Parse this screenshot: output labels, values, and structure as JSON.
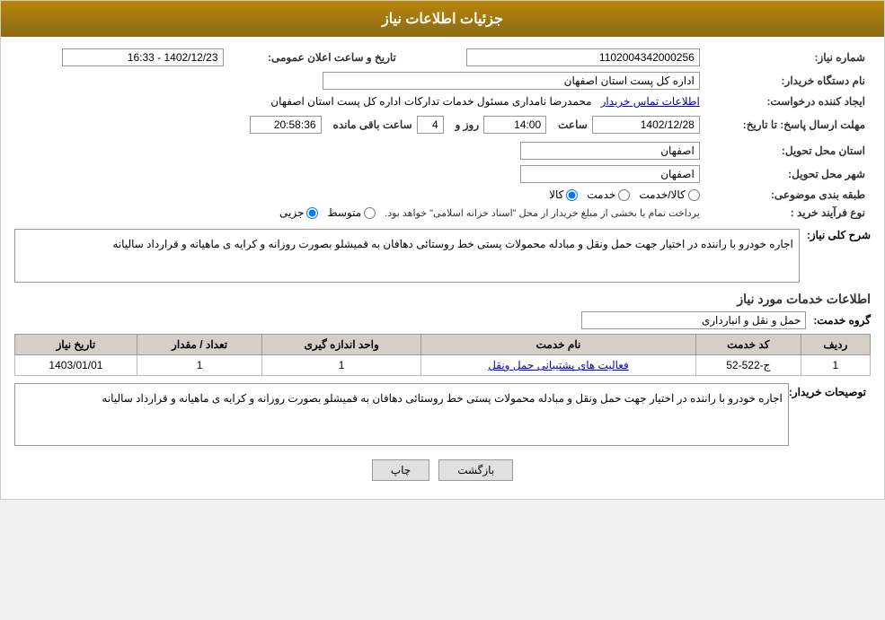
{
  "header": {
    "title": "جزئیات اطلاعات نیاز"
  },
  "fields": {
    "need_number_label": "شماره نیاز:",
    "need_number_value": "1102004342000256",
    "requester_org_label": "نام دستگاه خریدار:",
    "requester_org_value": "اداره کل پست استان اصفهان",
    "creator_label": "ایجاد کننده درخواست:",
    "creator_value": "محمدرضا نامداری مسئول خدمات تدارکات اداره کل پست استان اصفهان",
    "contact_link": "اطلاعات تماس خریدار",
    "date_label": "تاریخ و ساعت اعلان عمومی:",
    "date_value": "1402/12/23 - 16:33",
    "reply_deadline_label": "مهلت ارسال پاسخ: تا تاریخ:",
    "reply_date": "1402/12/28",
    "reply_time_label": "ساعت",
    "reply_time": "14:00",
    "reply_days_label": "روز و",
    "reply_days": "4",
    "reply_remaining_label": "ساعت باقی مانده",
    "reply_remaining": "20:58:36",
    "province_label": "استان محل تحویل:",
    "province_value": "اصفهان",
    "city_label": "شهر محل تحویل:",
    "city_value": "اصفهان",
    "category_label": "طبقه بندی موضوعی:",
    "category_kala": "کالا",
    "category_khedmat": "خدمت",
    "category_kala_khedmat": "کالا/خدمت",
    "process_label": "نوع فرآیند خرید :",
    "process_jozvi": "جزیی",
    "process_motavaset": "متوسط",
    "process_note": "پرداخت تمام یا بخشی از مبلغ خریدار از محل \"اسناد خزانه اسلامی\" خواهد بود.",
    "need_desc_label": "شرح کلی نیاز:",
    "need_desc_value": "اجاره خودرو با راننده در اختیار جهت حمل ونقل و مبادله محمولات  پستی خط روستائی دهافان به قمیشلو بصورت روزانه و کرایه ی ماهیانه و قرارداد سالیانه",
    "service_info_label": "اطلاعات خدمات مورد نیاز",
    "service_group_label": "گروه خدمت:",
    "service_group_value": "حمل و نقل و انبارداری",
    "table_headers": {
      "row_num": "ردیف",
      "service_code": "کد خدمت",
      "service_name": "نام خدمت",
      "unit": "واحد اندازه گیری",
      "quantity": "تعداد / مقدار",
      "date": "تاریخ نیاز"
    },
    "table_rows": [
      {
        "row": "1",
        "code": "ج-522-52",
        "name": "فعالیت های پشتیبانی حمل ونقل",
        "unit": "1",
        "quantity": "1",
        "date": "1403/01/01"
      }
    ],
    "buyer_desc_label": "توصیحات خریدار:",
    "buyer_desc_value": "اجاره خودرو با راننده در اختیار جهت حمل ونقل و مبادله محمولات  پستی خط روستائی دهافان به قمیشلو بصورت روزانه و کرایه ی ماهیانه و قرارداد سالیانه",
    "btn_print": "چاپ",
    "btn_back": "بازگشت"
  }
}
